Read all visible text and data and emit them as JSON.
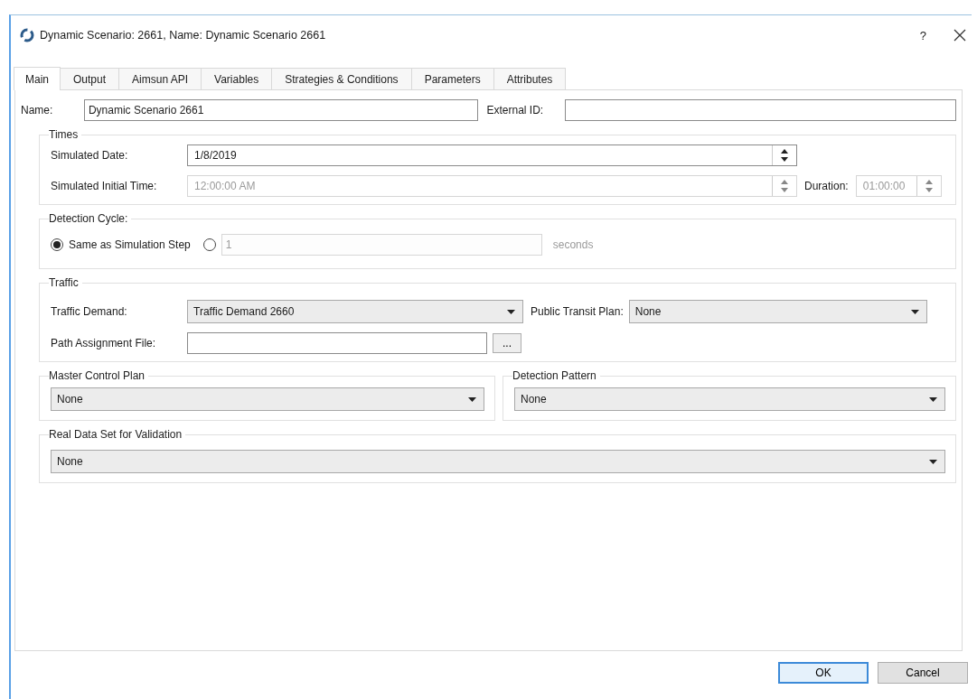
{
  "window": {
    "title": "Dynamic Scenario: 2661, Name: Dynamic Scenario 2661",
    "help": "?"
  },
  "tabs": [
    {
      "label": "Main",
      "selected": true
    },
    {
      "label": "Output",
      "selected": false
    },
    {
      "label": "Aimsun API",
      "selected": false
    },
    {
      "label": "Variables",
      "selected": false
    },
    {
      "label": "Strategies & Conditions",
      "selected": false
    },
    {
      "label": "Parameters",
      "selected": false
    },
    {
      "label": "Attributes",
      "selected": false
    }
  ],
  "name": {
    "label": "Name:",
    "value": "Dynamic Scenario 2661"
  },
  "external_id": {
    "label": "External ID:"
  },
  "times": {
    "title": "Times",
    "simulated_date": {
      "label": "Simulated Date:",
      "value": "1/8/2019",
      "disabled": false
    },
    "initial_time": {
      "label": "Simulated Initial Time:",
      "value": "12:00:00 AM",
      "disabled": true
    },
    "duration": {
      "label": "Duration:",
      "value": "01:00:00",
      "disabled": true
    }
  },
  "detection_cycle": {
    "title": "Detection Cycle:",
    "options": [
      {
        "label": "Same as Simulation Step",
        "selected": true
      },
      {
        "value": "1",
        "unit": "seconds",
        "selected": false,
        "disabled": true
      }
    ]
  },
  "traffic": {
    "title": "Traffic",
    "traffic_demand": {
      "label": "Traffic Demand:",
      "value": "Traffic Demand 2660"
    },
    "public_transit_plan": {
      "label": "Public Transit Plan:",
      "value": "None"
    },
    "path_assignment_file": {
      "label": "Path Assignment File:",
      "browse": "..."
    }
  },
  "master_control_plan": {
    "title": "Master Control Plan",
    "value": "None"
  },
  "detection_pattern": {
    "title": "Detection Pattern",
    "value": "None"
  },
  "real_data_set": {
    "title": "Real Data Set for Validation",
    "value": "None"
  },
  "buttons": [
    {
      "label": "OK",
      "default": true
    },
    {
      "label": "Cancel",
      "default": false
    }
  ]
}
